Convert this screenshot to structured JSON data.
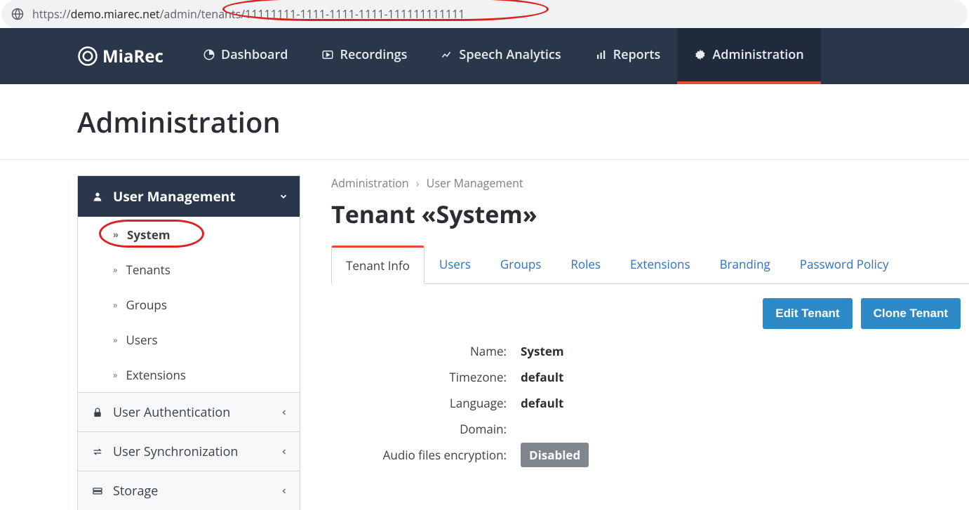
{
  "url": {
    "prefix": "https://",
    "host_bold": "demo.miarec.net",
    "path": "/admin/tenants/11111111-1111-1111-1111-111111111111"
  },
  "brand": "MiaRec",
  "nav": [
    {
      "label": "Dashboard"
    },
    {
      "label": "Recordings"
    },
    {
      "label": "Speech Analytics"
    },
    {
      "label": "Reports"
    },
    {
      "label": "Administration"
    }
  ],
  "page_title": "Administration",
  "sidebar": {
    "user_mgmt_label": "User Management",
    "items": [
      {
        "label": "System"
      },
      {
        "label": "Tenants"
      },
      {
        "label": "Groups"
      },
      {
        "label": "Users"
      },
      {
        "label": "Extensions"
      }
    ],
    "sections": [
      {
        "label": "User Authentication"
      },
      {
        "label": "User Synchronization"
      },
      {
        "label": "Storage"
      }
    ]
  },
  "breadcrumb": {
    "a": "Administration",
    "b": "User Management"
  },
  "tenant_title": "Tenant «System»",
  "tabs": [
    {
      "label": "Tenant Info"
    },
    {
      "label": "Users"
    },
    {
      "label": "Groups"
    },
    {
      "label": "Roles"
    },
    {
      "label": "Extensions"
    },
    {
      "label": "Branding"
    },
    {
      "label": "Password Policy"
    }
  ],
  "buttons": {
    "edit": "Edit Tenant",
    "clone": "Clone Tenant"
  },
  "fields": {
    "name_label": "Name:",
    "name_value": "System",
    "tz_label": "Timezone:",
    "tz_value": "default",
    "lang_label": "Language:",
    "lang_value": "default",
    "domain_label": "Domain:",
    "domain_value": "",
    "enc_label": "Audio files encryption:",
    "enc_value": "Disabled"
  }
}
